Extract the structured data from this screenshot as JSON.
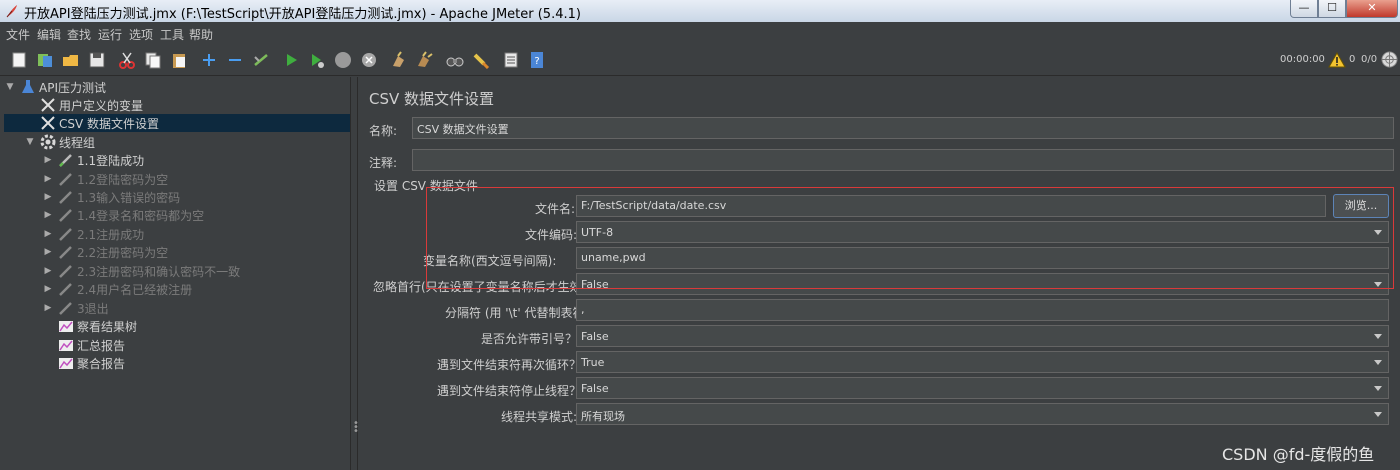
{
  "window": {
    "title": "开放API登陆压力测试.jmx (F:\\TestScript\\开放API登陆压力测试.jmx) - Apache JMeter (5.4.1)",
    "min_glyph": "—",
    "max_glyph": "☐",
    "close_glyph": "✕"
  },
  "menu": [
    "文件",
    "编辑",
    "查找",
    "运行",
    "选项",
    "工具",
    "帮助"
  ],
  "status": {
    "elapsed": "00:00:00",
    "warnings": "0",
    "threads": "0/0"
  },
  "tree": {
    "root": "API压力测试",
    "nodes": [
      "用户定义的变量",
      "CSV 数据文件设置",
      "线程组",
      "1.1登陆成功",
      "1.2登陆密码为空",
      "1.3输入错误的密码",
      "1.4登录名和密码都为空",
      "2.1注册成功",
      "2.2注册密码为空",
      "2.3注册密码和确认密码不一致",
      "2.4用户名已经被注册",
      "3退出",
      "察看结果树",
      "汇总报告",
      "聚合报告"
    ]
  },
  "panel": {
    "title": "CSV 数据文件设置",
    "name_label": "名称:",
    "name_value": "CSV 数据文件设置",
    "comment_label": "注释:",
    "comment_value": "",
    "group_title": "设置 CSV 数据文件",
    "filename_label": "文件名:",
    "filename_value": "F:/TestScript/data/date.csv",
    "browse_label": "浏览...",
    "encoding_label": "文件编码:",
    "encoding_value": "UTF-8",
    "varnames_label": "变量名称(西文逗号间隔):",
    "varnames_value": "uname,pwd",
    "ignore_first_label": "忽略首行(只在设置了变量名称后才生效):",
    "ignore_first_value": "False",
    "delimiter_label": "分隔符 (用 '\\t' 代替制表符):",
    "delimiter_value": ",",
    "quoted_label": "是否允许带引号？:",
    "quoted_value": "False",
    "recycle_label": "遇到文件结束符再次循环？:",
    "recycle_value": "True",
    "stop_label": "遇到文件结束符停止线程？:",
    "stop_value": "False",
    "share_label": "线程共享模式:",
    "share_value": "所有现场"
  },
  "watermark": "CSDN @fd-度假的鱼"
}
